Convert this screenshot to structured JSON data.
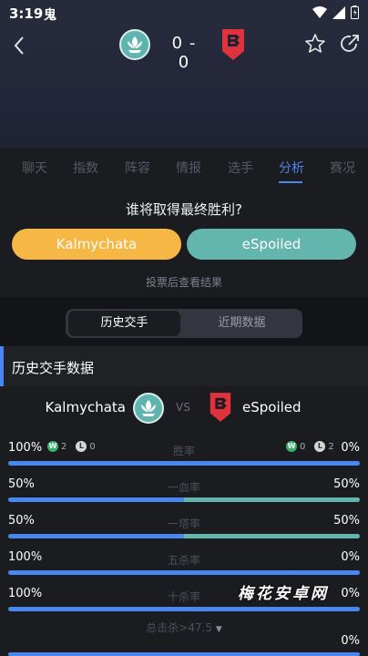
{
  "status_bar": {
    "time": "3:19",
    "app_glyph": "鬼"
  },
  "header": {
    "score": "0 - 0",
    "team_a_logo": "lotus-logo",
    "team_b_logo": "shield-b-logo"
  },
  "tabs": [
    {
      "label": "聊天",
      "active": false
    },
    {
      "label": "指数",
      "active": false
    },
    {
      "label": "阵容",
      "active": false
    },
    {
      "label": "情报",
      "active": false
    },
    {
      "label": "选手",
      "active": false
    },
    {
      "label": "分析",
      "active": true
    },
    {
      "label": "赛况",
      "active": false
    }
  ],
  "vote": {
    "question": "谁将取得最终胜利?",
    "team_a": "Kalmychata",
    "team_b": "eSpoiled",
    "hint": "投票后查看结果"
  },
  "segment": {
    "active": "历史交手",
    "inactive": "近期数据"
  },
  "section": {
    "title": "历史交手数据"
  },
  "versus": {
    "team_a": "Kalmychata",
    "vs": "VS",
    "team_b": "eSpoiled"
  },
  "stats": [
    {
      "label": "胜率",
      "left": "100%",
      "right": "0%",
      "a_win": "2",
      "a_loss": "0",
      "b_win": "0",
      "b_loss": "2",
      "a_fraction": 1.0,
      "b_fraction": 0.0
    },
    {
      "label": "一血率",
      "left": "50%",
      "right": "50%",
      "a_fraction": 0.5,
      "b_fraction": 0.5
    },
    {
      "label": "一塔率",
      "left": "50%",
      "right": "50%",
      "a_fraction": 0.5,
      "b_fraction": 0.5
    },
    {
      "label": "五杀率",
      "left": "100%",
      "right": "0%",
      "a_fraction": 1.0,
      "b_fraction": 0.0
    },
    {
      "label": "十杀率",
      "left": "100%",
      "right": "0%",
      "a_fraction": 1.0,
      "b_fraction": 0.0
    }
  ],
  "kills_filter": {
    "label": "总击杀>47.5",
    "right": "0%"
  },
  "badges": {
    "win": "W",
    "loss": "L"
  },
  "watermark": "梅花安卓网",
  "colors": {
    "accent": "#4a86f0",
    "team_a": "#f7b744",
    "team_b": "#62b6ad",
    "team_b_logo": "#e0323c"
  }
}
